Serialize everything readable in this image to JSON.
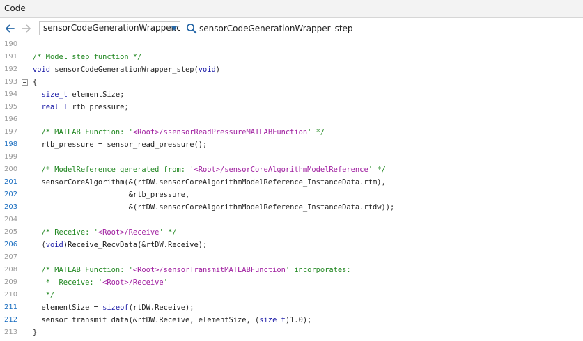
{
  "panel": {
    "title": "Code"
  },
  "toolbar": {
    "file_value": "sensorCodeGenerationWrapper.c",
    "search_value": "sensorCodeGenerationWrapper_step"
  },
  "colors": {
    "comment": "#228822",
    "keyword": "#1a1aa6",
    "string": "#a020a0",
    "line_number": "#9a9a9a",
    "line_number_link": "#1a6ec0"
  },
  "code": {
    "lines": [
      {
        "num": "190",
        "link": false,
        "fold": false,
        "tokens": []
      },
      {
        "num": "191",
        "link": false,
        "fold": false,
        "tokens": [
          {
            "t": "comment",
            "v": "/* Model step function */"
          }
        ]
      },
      {
        "num": "192",
        "link": false,
        "fold": false,
        "tokens": [
          {
            "t": "keyword",
            "v": "void"
          },
          {
            "t": "plain",
            "v": " sensorCodeGenerationWrapper_step("
          },
          {
            "t": "keyword",
            "v": "void"
          },
          {
            "t": "plain",
            "v": ")"
          }
        ]
      },
      {
        "num": "193",
        "link": false,
        "fold": true,
        "tokens": [
          {
            "t": "plain",
            "v": "{"
          }
        ]
      },
      {
        "num": "194",
        "link": false,
        "fold": false,
        "tokens": [
          {
            "t": "plain",
            "v": "  "
          },
          {
            "t": "type",
            "v": "size_t"
          },
          {
            "t": "plain",
            "v": " elementSize;"
          }
        ]
      },
      {
        "num": "195",
        "link": false,
        "fold": false,
        "tokens": [
          {
            "t": "plain",
            "v": "  "
          },
          {
            "t": "type",
            "v": "real_T"
          },
          {
            "t": "plain",
            "v": " rtb_pressure;"
          }
        ]
      },
      {
        "num": "196",
        "link": false,
        "fold": false,
        "tokens": []
      },
      {
        "num": "197",
        "link": false,
        "fold": false,
        "tokens": [
          {
            "t": "plain",
            "v": "  "
          },
          {
            "t": "comment",
            "v": "/* MATLAB Function: '"
          },
          {
            "t": "string",
            "v": "<Root>/ssensorReadPressureMATLABFunction"
          },
          {
            "t": "comment",
            "v": "' */"
          }
        ]
      },
      {
        "num": "198",
        "link": true,
        "fold": false,
        "tokens": [
          {
            "t": "plain",
            "v": "  rtb_pressure = sensor_read_pressure();"
          }
        ]
      },
      {
        "num": "199",
        "link": false,
        "fold": false,
        "tokens": []
      },
      {
        "num": "200",
        "link": false,
        "fold": false,
        "tokens": [
          {
            "t": "plain",
            "v": "  "
          },
          {
            "t": "comment",
            "v": "/* ModelReference generated from: '"
          },
          {
            "t": "string",
            "v": "<Root>/sensorCoreAlgorithmModelReference"
          },
          {
            "t": "comment",
            "v": "' */"
          }
        ]
      },
      {
        "num": "201",
        "link": true,
        "fold": false,
        "tokens": [
          {
            "t": "plain",
            "v": "  sensorCoreAlgorithm(&(rtDW.sensorCoreAlgorithmModelReference_InstanceData.rtm),"
          }
        ]
      },
      {
        "num": "202",
        "link": true,
        "fold": false,
        "tokens": [
          {
            "t": "plain",
            "v": "                      &rtb_pressure,"
          }
        ]
      },
      {
        "num": "203",
        "link": true,
        "fold": false,
        "tokens": [
          {
            "t": "plain",
            "v": "                      &(rtDW.sensorCoreAlgorithmModelReference_InstanceData.rtdw));"
          }
        ]
      },
      {
        "num": "204",
        "link": false,
        "fold": false,
        "tokens": []
      },
      {
        "num": "205",
        "link": false,
        "fold": false,
        "tokens": [
          {
            "t": "plain",
            "v": "  "
          },
          {
            "t": "comment",
            "v": "/* Receive: '"
          },
          {
            "t": "string",
            "v": "<Root>/Receive"
          },
          {
            "t": "comment",
            "v": "' */"
          }
        ]
      },
      {
        "num": "206",
        "link": true,
        "fold": false,
        "tokens": [
          {
            "t": "plain",
            "v": "  ("
          },
          {
            "t": "keyword",
            "v": "void"
          },
          {
            "t": "plain",
            "v": ")Receive_RecvData(&rtDW.Receive);"
          }
        ]
      },
      {
        "num": "207",
        "link": false,
        "fold": false,
        "tokens": []
      },
      {
        "num": "208",
        "link": false,
        "fold": false,
        "tokens": [
          {
            "t": "plain",
            "v": "  "
          },
          {
            "t": "comment",
            "v": "/* MATLAB Function: '"
          },
          {
            "t": "string",
            "v": "<Root>/sensorTransmitMATLABFunction"
          },
          {
            "t": "comment",
            "v": "' incorporates:"
          }
        ]
      },
      {
        "num": "209",
        "link": false,
        "fold": false,
        "tokens": [
          {
            "t": "plain",
            "v": "   "
          },
          {
            "t": "comment",
            "v": "*  Receive: '"
          },
          {
            "t": "string",
            "v": "<Root>/Receive"
          },
          {
            "t": "comment",
            "v": "'"
          }
        ]
      },
      {
        "num": "210",
        "link": false,
        "fold": false,
        "tokens": [
          {
            "t": "plain",
            "v": "   "
          },
          {
            "t": "comment",
            "v": "*/"
          }
        ]
      },
      {
        "num": "211",
        "link": true,
        "fold": false,
        "tokens": [
          {
            "t": "plain",
            "v": "  elementSize = "
          },
          {
            "t": "keyword",
            "v": "sizeof"
          },
          {
            "t": "plain",
            "v": "(rtDW.Receive);"
          }
        ]
      },
      {
        "num": "212",
        "link": true,
        "fold": false,
        "tokens": [
          {
            "t": "plain",
            "v": "  sensor_transmit_data(&rtDW.Receive, elementSize, ("
          },
          {
            "t": "type",
            "v": "size_t"
          },
          {
            "t": "plain",
            "v": ")1.0);"
          }
        ]
      },
      {
        "num": "213",
        "link": false,
        "fold": false,
        "tokens": [
          {
            "t": "plain",
            "v": "}"
          }
        ]
      }
    ]
  }
}
